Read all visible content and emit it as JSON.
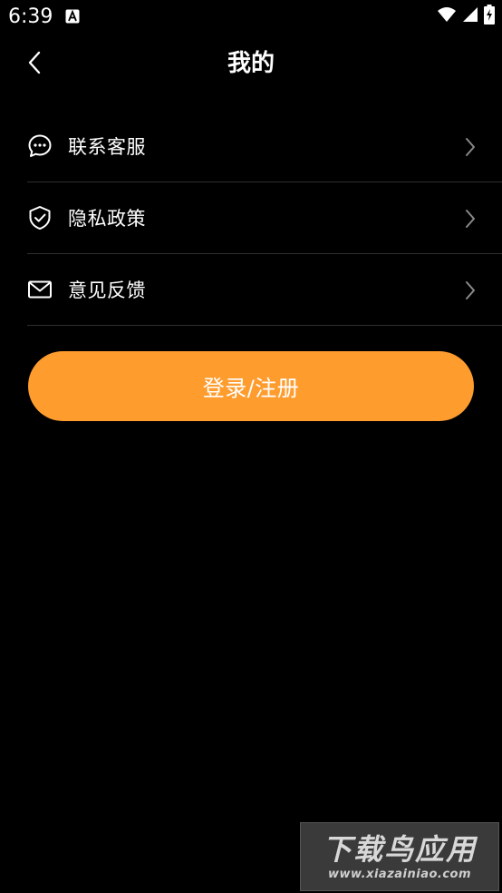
{
  "status_bar": {
    "time": "6:39",
    "notification_icon": "a-letter-icon",
    "wifi_icon": "wifi-icon",
    "signal_icon": "signal-icon",
    "battery_icon": "battery-charging-icon"
  },
  "header": {
    "back_icon": "chevron-left-icon",
    "title": "我的"
  },
  "menu": {
    "items": [
      {
        "label": "联系客服",
        "icon": "chat-bubble-icon"
      },
      {
        "label": "隐私政策",
        "icon": "shield-check-icon"
      },
      {
        "label": "意见反馈",
        "icon": "mail-icon"
      }
    ],
    "chevron_icon": "chevron-right-icon"
  },
  "login_button": {
    "label": "登录/注册"
  },
  "colors": {
    "background": "#000000",
    "accent": "#FF9C2E",
    "text": "#FFFFFF",
    "divider": "#2F2F2F",
    "chevron": "#8A8A8A"
  },
  "watermark": {
    "main": "下载鸟应用",
    "sub": "www.xiazainiao.com"
  }
}
